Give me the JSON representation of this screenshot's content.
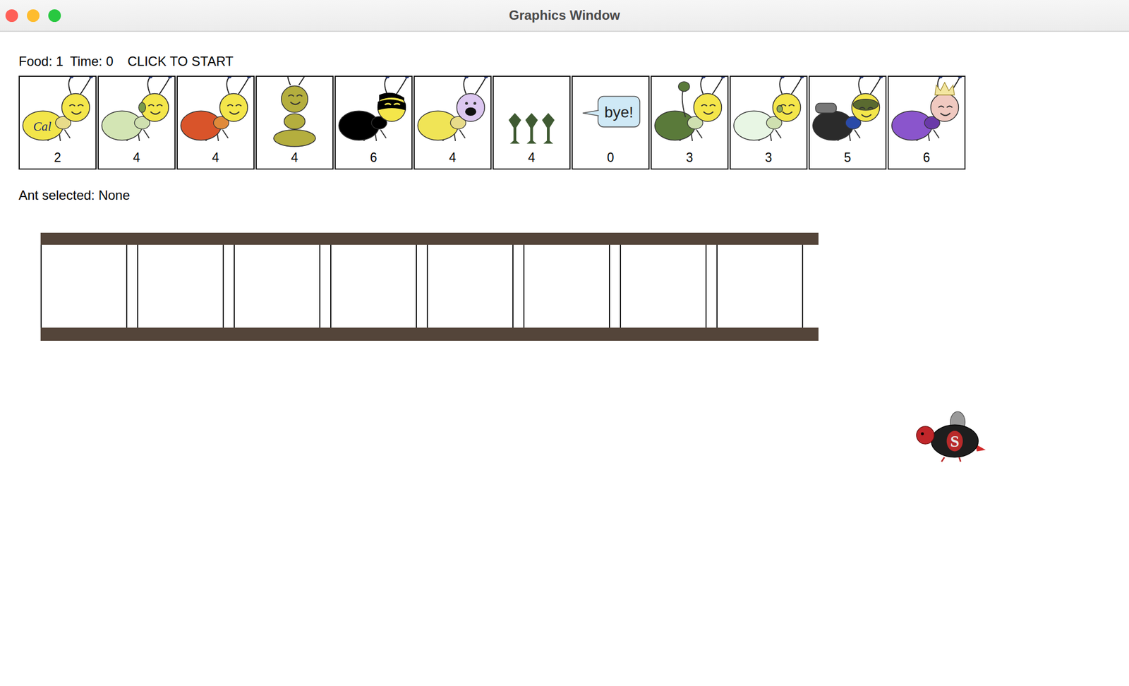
{
  "window": {
    "title": "Graphics Window"
  },
  "status": {
    "food": "Food: 1",
    "time": "Time: 0",
    "prompt": "CLICK TO START"
  },
  "ants": [
    {
      "kind": "harvester",
      "cost": "2",
      "color": "#f2e54a",
      "badge": "Cal",
      "selected": false
    },
    {
      "kind": "thrower",
      "cost": "4",
      "color": "#d3e5b4",
      "selected": false
    },
    {
      "kind": "fire",
      "cost": "4",
      "color": "#d9542a",
      "selected": false
    },
    {
      "kind": "wall",
      "cost": "4",
      "color": "#b4ae3e",
      "selected": false
    },
    {
      "kind": "ninja",
      "cost": "6",
      "color": "#000000",
      "selected": false
    },
    {
      "kind": "hungry",
      "cost": "4",
      "color": "#f0e456",
      "selected": false
    },
    {
      "kind": "plants",
      "cost": "4",
      "color": "#3f5a32",
      "selected": false
    },
    {
      "kind": "bye",
      "cost": "0",
      "color": "#cfe9f6",
      "bubble": "bye!",
      "selected": false
    },
    {
      "kind": "long-thrower",
      "cost": "3",
      "color": "#5a7a3a",
      "selected": false
    },
    {
      "kind": "short-thrower",
      "cost": "3",
      "color": "#e8f6e4",
      "selected": false
    },
    {
      "kind": "bodyguard",
      "cost": "5",
      "color": "#2b2b2b",
      "selected": false
    },
    {
      "kind": "queen",
      "cost": "6",
      "color": "#8a55cc",
      "selected": false
    }
  ],
  "selection": "Ant selected: None",
  "places": [
    {
      "kind": "tunnel"
    },
    {
      "kind": "tunnel"
    },
    {
      "kind": "tunnel"
    },
    {
      "kind": "tunnel"
    },
    {
      "kind": "tunnel"
    },
    {
      "kind": "tunnel"
    },
    {
      "kind": "tunnel"
    },
    {
      "kind": "tunnel"
    }
  ],
  "bees": [
    {
      "kind": "bee",
      "logo": "S"
    }
  ]
}
